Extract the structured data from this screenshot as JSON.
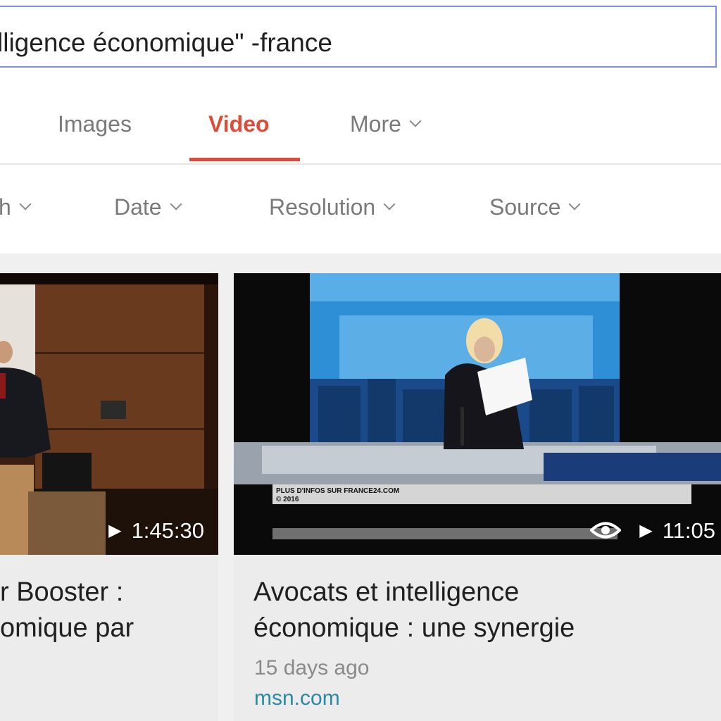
{
  "search": {
    "query": "lligence économique\" -france"
  },
  "tabs": [
    {
      "label": "Images",
      "active": false
    },
    {
      "label": "Video",
      "active": true
    },
    {
      "label": "More",
      "active": false
    }
  ],
  "filters": [
    {
      "label": "h"
    },
    {
      "label": "Date"
    },
    {
      "label": "Resolution"
    },
    {
      "label": "Source"
    }
  ],
  "results": [
    {
      "duration": "1:45:30",
      "title_lines": [
        "r Booster :",
        "omique par"
      ]
    },
    {
      "duration": "11:05",
      "title_lines": [
        "Avocats et intelligence",
        "économique : une synergie"
      ],
      "age": "15 days ago",
      "source": "msn.com",
      "overlay_text": [
        "PLUS D'INFOS SUR FRANCE24.COM",
        "© 2016"
      ]
    }
  ],
  "colors": {
    "accent": "#dd4b39",
    "link": "#2b8aa1",
    "search_border": "#7b8fe6"
  },
  "icons": [
    "chevron-down-icon",
    "play-icon",
    "eye-icon"
  ]
}
